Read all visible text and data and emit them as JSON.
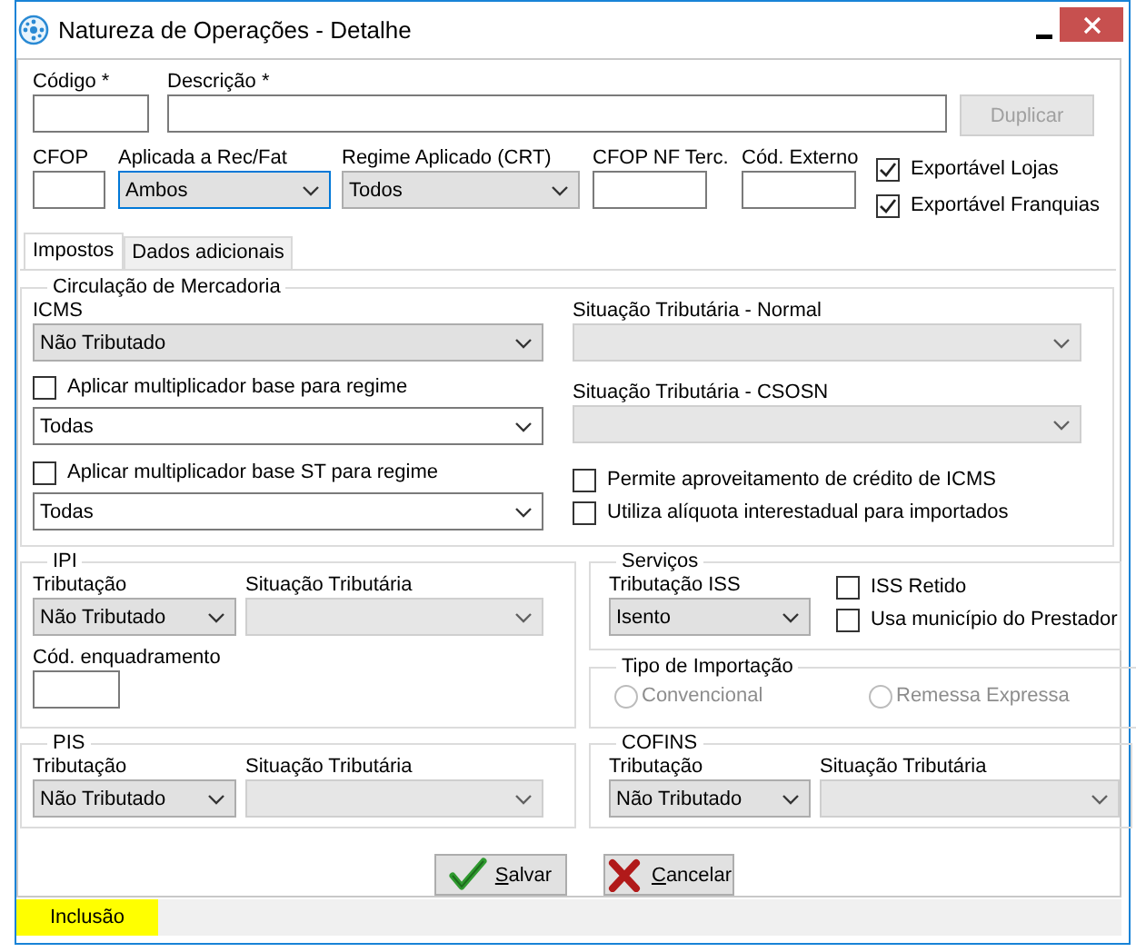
{
  "window": {
    "title": "Natureza de Operações - Detalhe"
  },
  "header": {
    "code": {
      "label": "Código *"
    },
    "description": {
      "label": "Descrição *"
    },
    "duplicate_button": {
      "label": "Duplicar",
      "disabled": true
    },
    "cfop": {
      "label": "CFOP"
    },
    "applied_to": {
      "label": "Aplicada a Rec/Fat",
      "kind": "dropdown",
      "value": "Ambos",
      "focused": true
    },
    "regime": {
      "label": "Regime Aplicado (CRT)",
      "kind": "dropdown",
      "value": "Todos"
    },
    "cfop_nf": {
      "label": "CFOP NF Terc."
    },
    "external_code": {
      "label": "Cód. Externo"
    }
  },
  "export_options": [
    {
      "label": "Exportável Lojas",
      "checked": true
    },
    {
      "label": "Exportável Franquias",
      "checked": true
    }
  ],
  "tabs": [
    {
      "label": "Impostos",
      "selected": true
    },
    {
      "label": "Dados adicionais",
      "selected": false
    }
  ],
  "icms": {
    "title": "Circulação de Mercadoria",
    "icms": {
      "label": "ICMS",
      "kind": "dropdown",
      "value": "Não Tributado"
    },
    "base_multiplier": {
      "label": "Aplicar multiplicador base para regime",
      "checked": false
    },
    "base_regime": {
      "kind": "combo",
      "value": "Todas"
    },
    "st_multiplier": {
      "label": "Aplicar multiplicador base ST para regime",
      "checked": false
    },
    "st_regime": {
      "kind": "combo",
      "value": "Todas"
    },
    "normal": {
      "label": "Situação Tributária - Normal",
      "kind": "dropdown",
      "disabled": true
    },
    "csosn": {
      "label": "Situação Tributária - CSOSN",
      "kind": "dropdown",
      "disabled": true
    },
    "options": [
      {
        "label": "Permite aproveitamento de crédito de ICMS",
        "checked": false
      },
      {
        "label": "Utiliza alíquota interestadual para importados",
        "checked": false
      }
    ]
  },
  "ipi": {
    "title": "IPI",
    "taxation": {
      "label": "Tributação",
      "kind": "dropdown",
      "value": "Não Tributado"
    },
    "situation": {
      "label": "Situação Tributária",
      "kind": "dropdown",
      "disabled": true
    },
    "framing_code": {
      "label": "Cód. enquadramento"
    }
  },
  "services": {
    "title": "Serviços",
    "taxation": {
      "label": "Tributação ISS",
      "kind": "dropdown",
      "value": "Isento"
    },
    "options": [
      {
        "label": "ISS Retido",
        "checked": false
      },
      {
        "label": "Usa município do Prestador",
        "checked": false
      }
    ]
  },
  "import_type": {
    "title": "Tipo de Importação",
    "options": [
      {
        "label": "Convencional",
        "selected": false,
        "disabled": true
      },
      {
        "label": "Remessa Expressa",
        "selected": false,
        "disabled": true
      }
    ]
  },
  "pis": {
    "title": "PIS",
    "taxation": {
      "label": "Tributação",
      "kind": "dropdown",
      "value": "Não Tributado"
    },
    "situation": {
      "label": "Situação Tributária",
      "kind": "dropdown",
      "disabled": true
    }
  },
  "cofins": {
    "title": "COFINS",
    "taxation": {
      "label": "Tributação",
      "kind": "dropdown",
      "value": "Não Tributado"
    },
    "situation": {
      "label": "Situação Tributária",
      "kind": "dropdown",
      "disabled": true
    }
  },
  "buttons": [
    {
      "label": "Salvar",
      "kind": "save"
    },
    {
      "label": "Cancelar",
      "kind": "cancel"
    }
  ],
  "status_bar": {
    "mode": "Inclusão"
  }
}
